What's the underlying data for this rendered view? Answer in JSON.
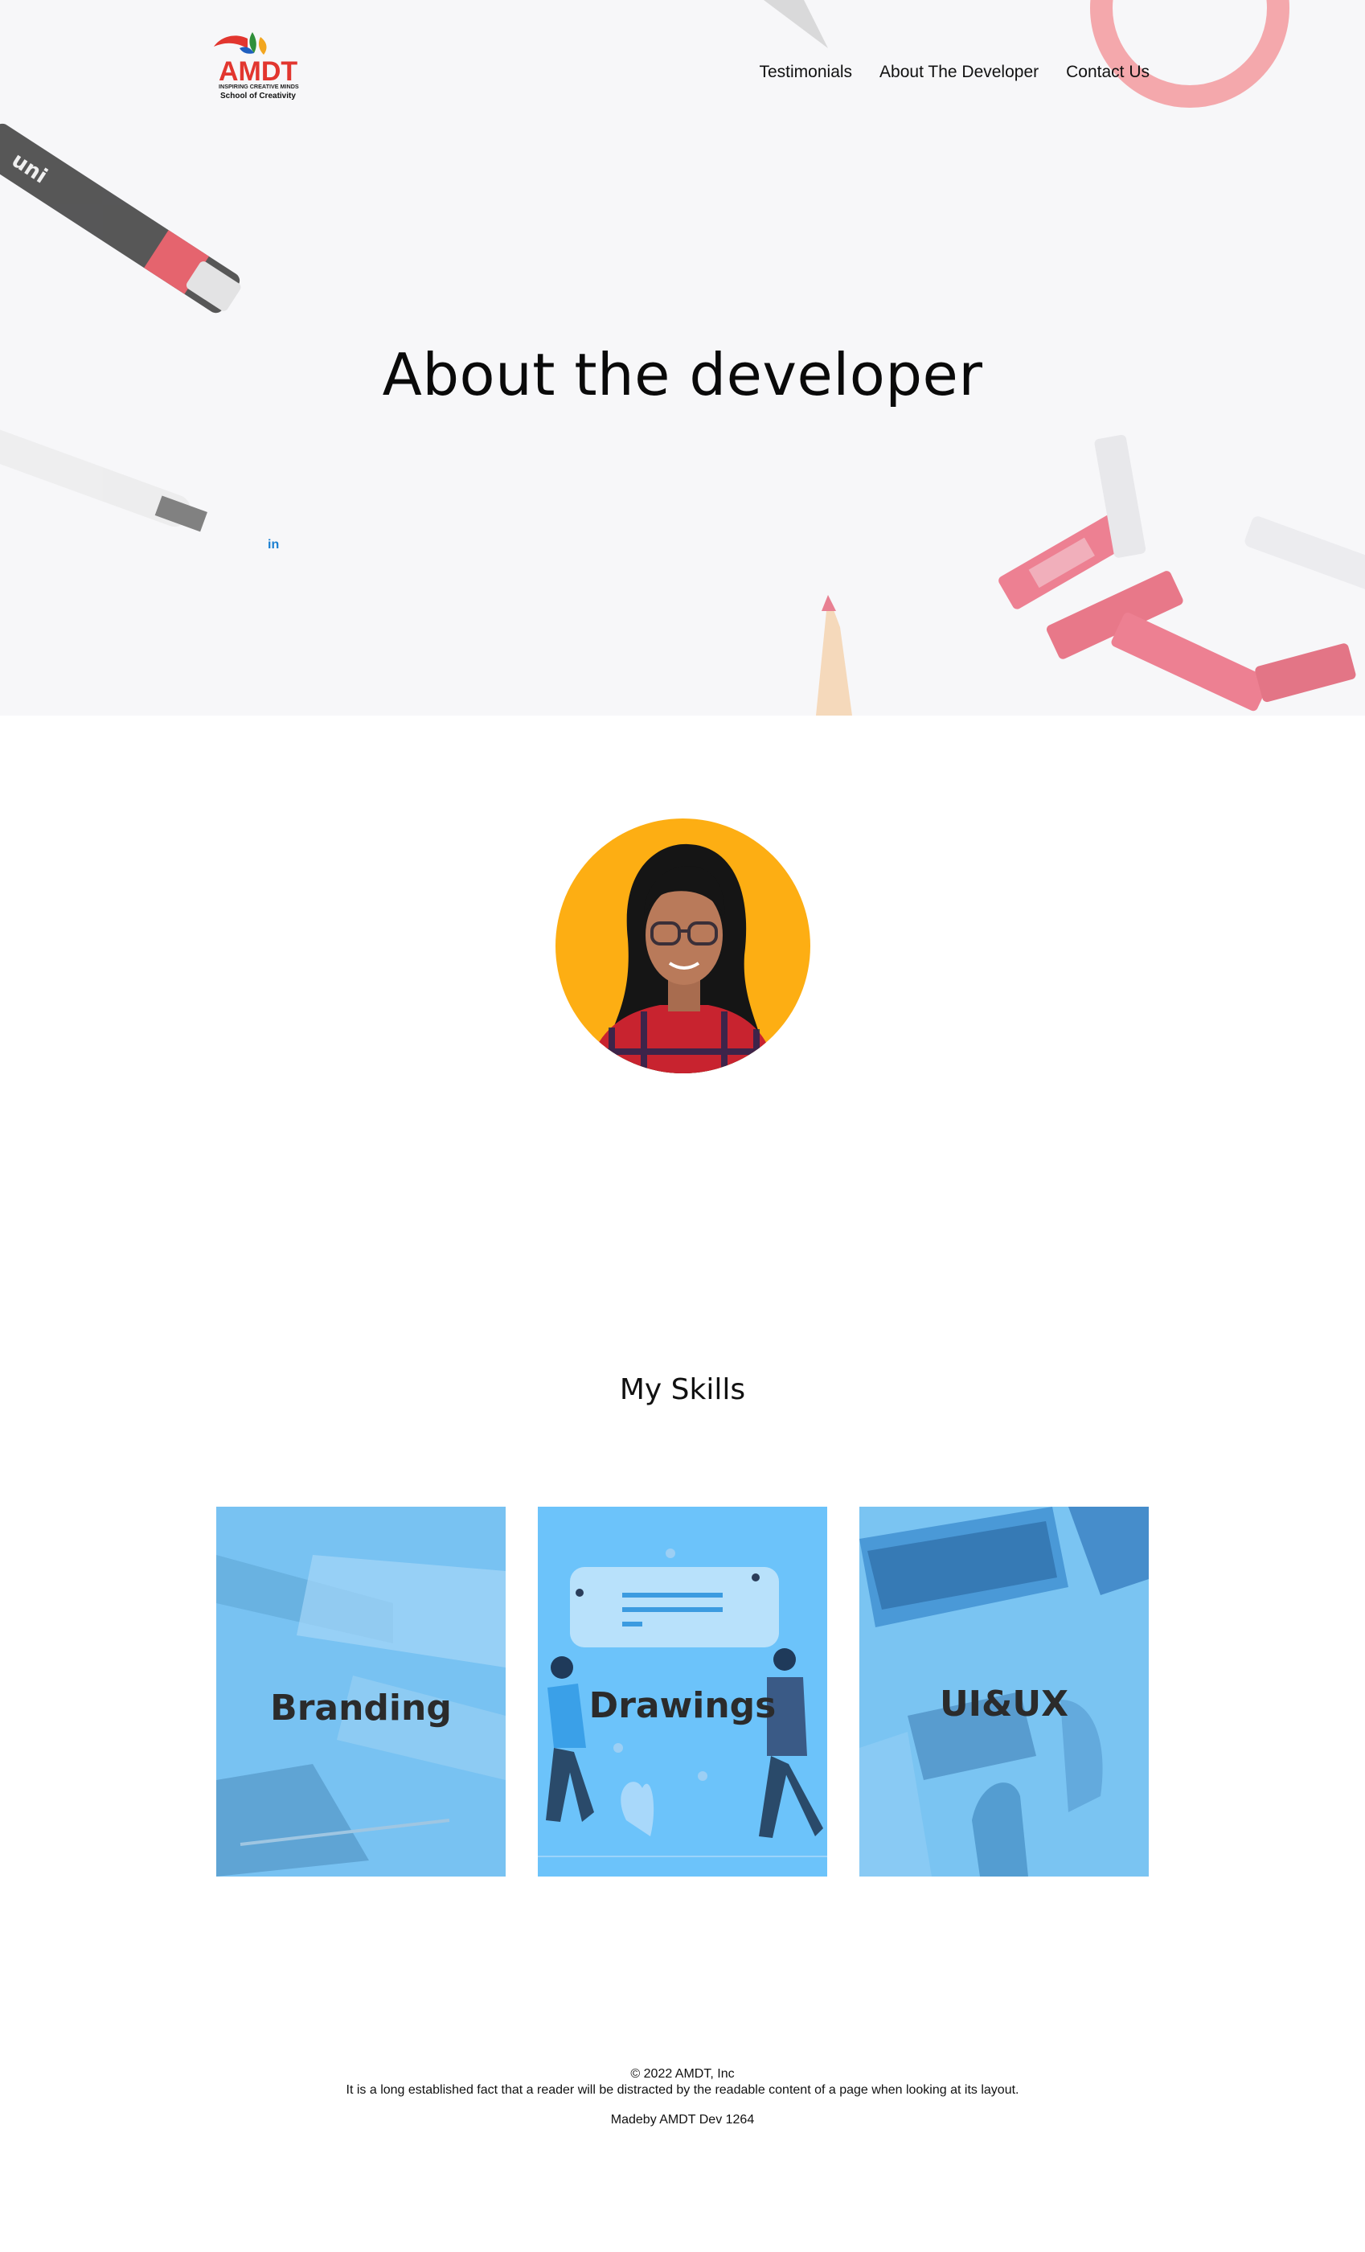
{
  "header": {
    "logo": {
      "brand": "AMDT",
      "tagline": "INSPIRING CREATIVE MINDS",
      "subtitle": "School of Creativity"
    },
    "nav": [
      "Testimonials",
      "About The Developer",
      "Contact Us"
    ]
  },
  "hero": {
    "title": "About the developer",
    "social_icon": "linkedin-icon",
    "social_label": "in"
  },
  "profile": {
    "avatar_bg": "#FDAE13"
  },
  "skills": {
    "title": "My Skills",
    "cards": [
      {
        "label": "Branding"
      },
      {
        "label": "Drawings"
      },
      {
        "label": "UI&UX"
      }
    ]
  },
  "footer": {
    "copyright": "© 2022 AMDT, Inc",
    "text": "It is a long established fact that a reader will be distracted by the readable content of a page when looking at its layout.",
    "made_by": "Madeby AMDT Dev 1264"
  },
  "colors": {
    "accent_blue": "#6CC3FA",
    "link_blue": "#1A7FD1",
    "hero_bg": "#F7F7F9"
  }
}
